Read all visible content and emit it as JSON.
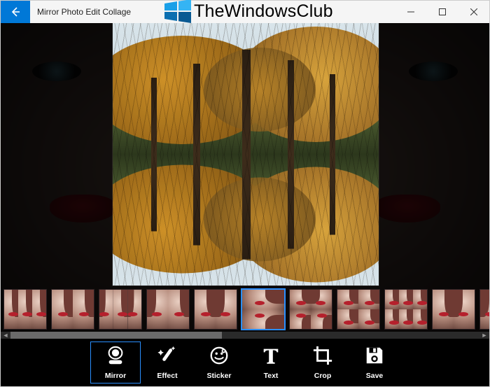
{
  "window": {
    "title": "Mirror Photo Edit Collage"
  },
  "brand": {
    "text": "TheWindowsClub",
    "logo_colors": {
      "c1": "#1aa0e8",
      "c2": "#0b6fb0",
      "c3": "#34b4f4",
      "c4": "#0a5a93"
    }
  },
  "thumbs": {
    "selected_index": 5,
    "count": 11
  },
  "toolbar": {
    "active_index": 0,
    "items": [
      {
        "id": "mirror",
        "label": "Mirror"
      },
      {
        "id": "effect",
        "label": "Effect"
      },
      {
        "id": "sticker",
        "label": "Sticker"
      },
      {
        "id": "text",
        "label": "Text"
      },
      {
        "id": "crop",
        "label": "Crop"
      },
      {
        "id": "save",
        "label": "Save"
      }
    ]
  }
}
